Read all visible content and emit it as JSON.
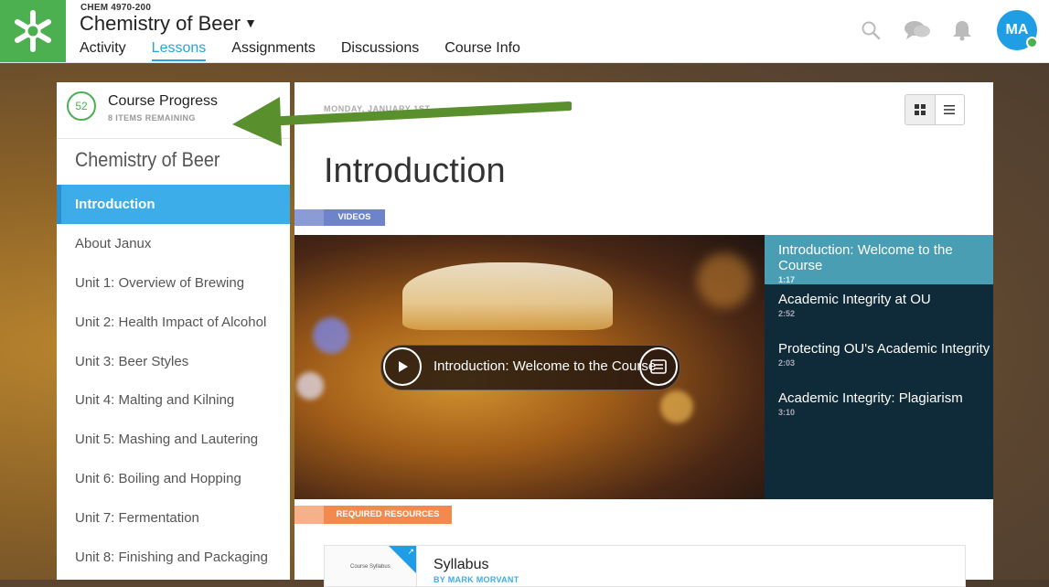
{
  "header": {
    "course_code": "CHEM 4970-200",
    "course_title": "Chemistry of Beer",
    "tabs": [
      {
        "label": "Activity"
      },
      {
        "label": "Lessons"
      },
      {
        "label": "Assignments"
      },
      {
        "label": "Discussions"
      },
      {
        "label": "Course Info"
      }
    ],
    "active_tab": "Lessons",
    "avatar_initials": "MA",
    "icons": [
      "search-icon",
      "chat-icon",
      "bell-icon"
    ]
  },
  "sidebar": {
    "progress_value": "52",
    "progress_title": "Course Progress",
    "progress_sub": "8 ITEMS REMAINING",
    "course_name": "Chemistry of Beer",
    "lessons": [
      {
        "label": "Introduction"
      },
      {
        "label": "About Janux"
      },
      {
        "label": "Unit 1: Overview of Brewing"
      },
      {
        "label": "Unit 2: Health Impact of Alcohol"
      },
      {
        "label": "Unit 3: Beer Styles"
      },
      {
        "label": "Unit 4: Malting and Kilning"
      },
      {
        "label": "Unit 5: Mashing and Lautering"
      },
      {
        "label": "Unit 6: Boiling and Hopping"
      },
      {
        "label": "Unit 7: Fermentation"
      },
      {
        "label": "Unit 8: Finishing and Packaging"
      }
    ]
  },
  "main": {
    "date": "MONDAY, JANUARY 1ST",
    "title": "Introduction",
    "videos_label": "VIDEOS",
    "player_caption": "Introduction: Welcome to the Course",
    "playlist": [
      {
        "title": "Introduction: Welcome to the Course",
        "duration": "1:17"
      },
      {
        "title": "Academic Integrity at OU",
        "duration": "2:52"
      },
      {
        "title": "Protecting OU's Academic Integrity",
        "duration": "2:03"
      },
      {
        "title": "Academic Integrity: Plagiarism",
        "duration": "3:10"
      }
    ],
    "required_label": "REQUIRED RESOURCES",
    "resource": {
      "thumb_text": "Course Syllabus",
      "title": "Syllabus",
      "author": "BY MARK MORVANT"
    }
  },
  "colors": {
    "brand_green": "#4caf50",
    "accent_blue": "#3dade9",
    "arrow_green": "#5a8f2e"
  }
}
